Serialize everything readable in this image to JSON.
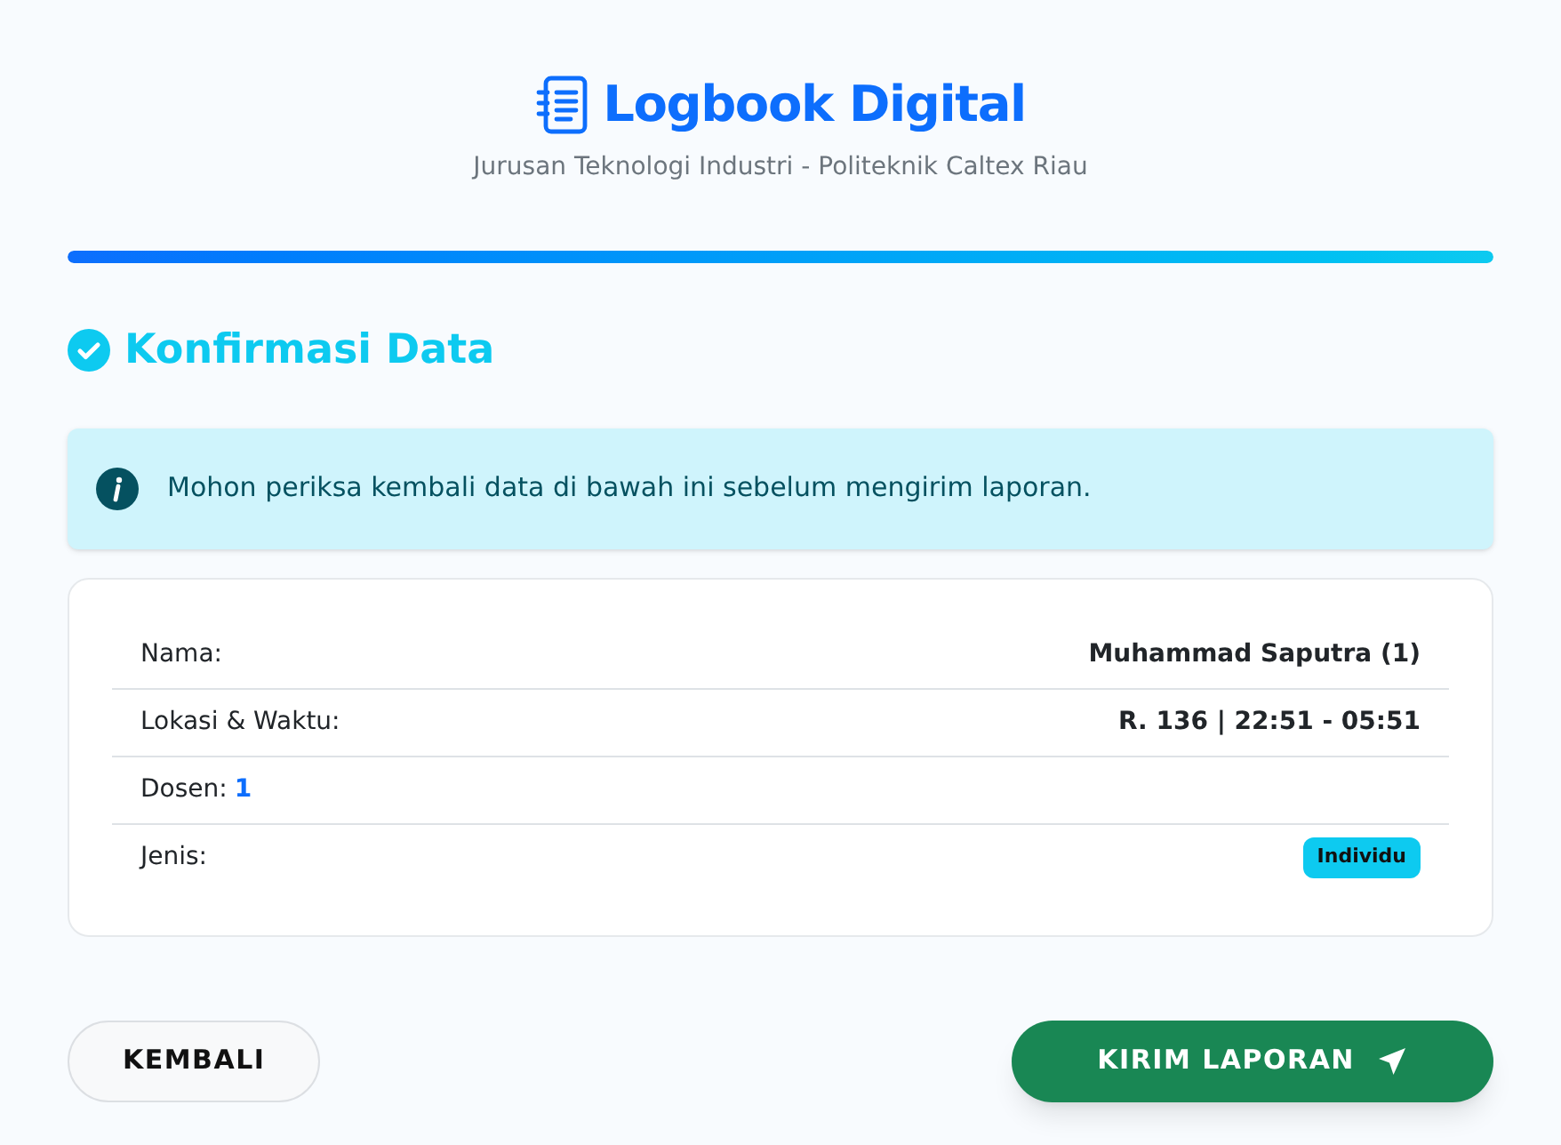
{
  "header": {
    "title": "Logbook Digital",
    "subtitle": "Jurusan Teknologi Industri - Politeknik Caltex Riau"
  },
  "progress": {
    "level": 1
  },
  "section": {
    "title": "Konfirmasi Data"
  },
  "alert": {
    "text": "Mohon periksa kembali data di bawah ini sebelum mengirim laporan."
  },
  "rows": [
    {
      "kind": "text",
      "label": "Nama:",
      "value": "Muhammad Saputra (1)"
    },
    {
      "kind": "text",
      "label": "Lokasi & Waktu:",
      "value": "R. 136 | 22:51 - 05:51"
    },
    {
      "kind": "inline",
      "label": "Dosen:",
      "value": "1"
    },
    {
      "kind": "badge",
      "label": "Jenis:",
      "value": "Individu"
    }
  ],
  "buttons": {
    "back": "KEMBALI",
    "submit": "KIRIM LAPORAN"
  }
}
